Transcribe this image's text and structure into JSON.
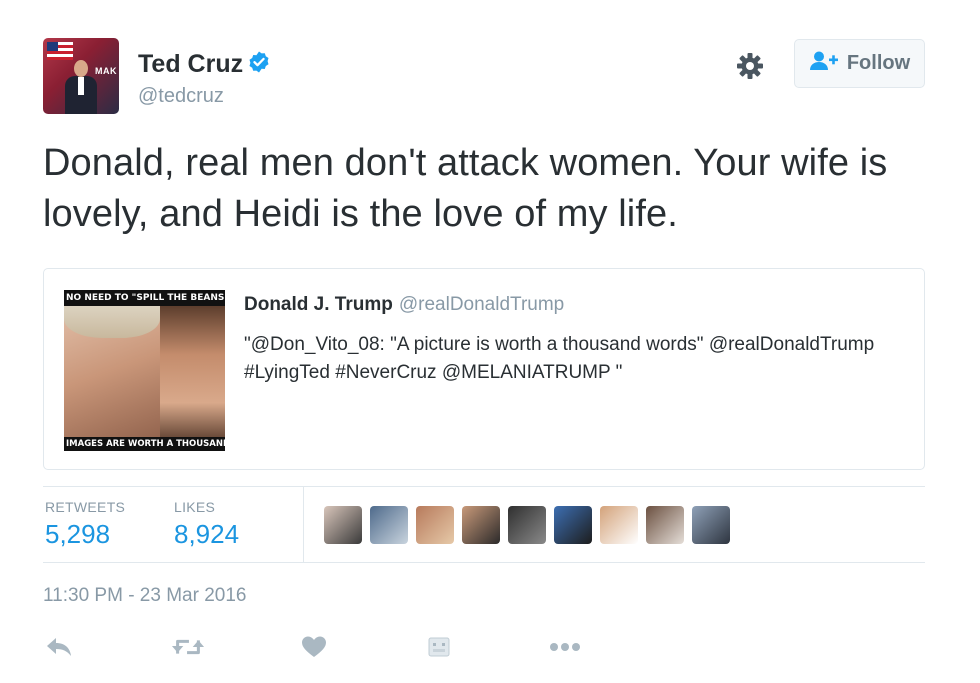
{
  "tweet": {
    "author_name": "Ted Cruz",
    "author_handle": "@tedcruz",
    "avatar_text": "MAK",
    "follow_label": "Follow",
    "text": "Donald, real men don't attack women. Your wife is lovely, and Heidi is the love of my life.",
    "timestamp": "11:30 PM - 23 Mar 2016"
  },
  "quoted_tweet": {
    "author_name": "Donald J. Trump",
    "author_handle": "@realDonaldTrump",
    "text": "\"@Don_Vito_08: \"A picture is worth a thousand words\" @realDonaldTrump  #LyingTed #NeverCruz  @MELANIATRUMP \"",
    "image_caption_top": "NO NEED TO \"SPILL THE BEANS\"",
    "image_caption_bottom": "IMAGES ARE WORTH A THOUSAND WORDS"
  },
  "stats": {
    "retweets_label": "RETWEETS",
    "retweets_value": "5,298",
    "likes_label": "LIKES",
    "likes_value": "8,924"
  },
  "liker_avatars": [
    {
      "name": "liker-avatar-1",
      "colors": [
        "#d9c6bb",
        "#3a3a3a"
      ]
    },
    {
      "name": "liker-avatar-2",
      "colors": [
        "#4e6a8b",
        "#c9d4de"
      ]
    },
    {
      "name": "liker-avatar-3",
      "colors": [
        "#b77a5c",
        "#e6c9a8"
      ]
    },
    {
      "name": "liker-avatar-4",
      "colors": [
        "#c99a7a",
        "#2c2a2a"
      ]
    },
    {
      "name": "liker-avatar-5",
      "colors": [
        "#2f2f2f",
        "#8a8a8a"
      ]
    },
    {
      "name": "liker-avatar-6",
      "colors": [
        "#3d6fb3",
        "#1d1d1d"
      ]
    },
    {
      "name": "liker-avatar-7",
      "colors": [
        "#d3a27a",
        "#ffffff"
      ]
    },
    {
      "name": "liker-avatar-8",
      "colors": [
        "#6b5040",
        "#e5ded8"
      ]
    },
    {
      "name": "liker-avatar-9",
      "colors": [
        "#8fa1b8",
        "#2e3540"
      ]
    }
  ],
  "icons": [
    "verified-badge-icon",
    "gear-icon",
    "follow-person-icon",
    "reply-icon",
    "retweet-icon",
    "like-icon",
    "direct-message-icon",
    "more-icon"
  ],
  "colors": {
    "accent": "#1b95e0",
    "secondary_text": "#8899a6",
    "primary_text": "#292f33",
    "border": "#e1e8ed",
    "action_icon": "#aab8c2"
  }
}
